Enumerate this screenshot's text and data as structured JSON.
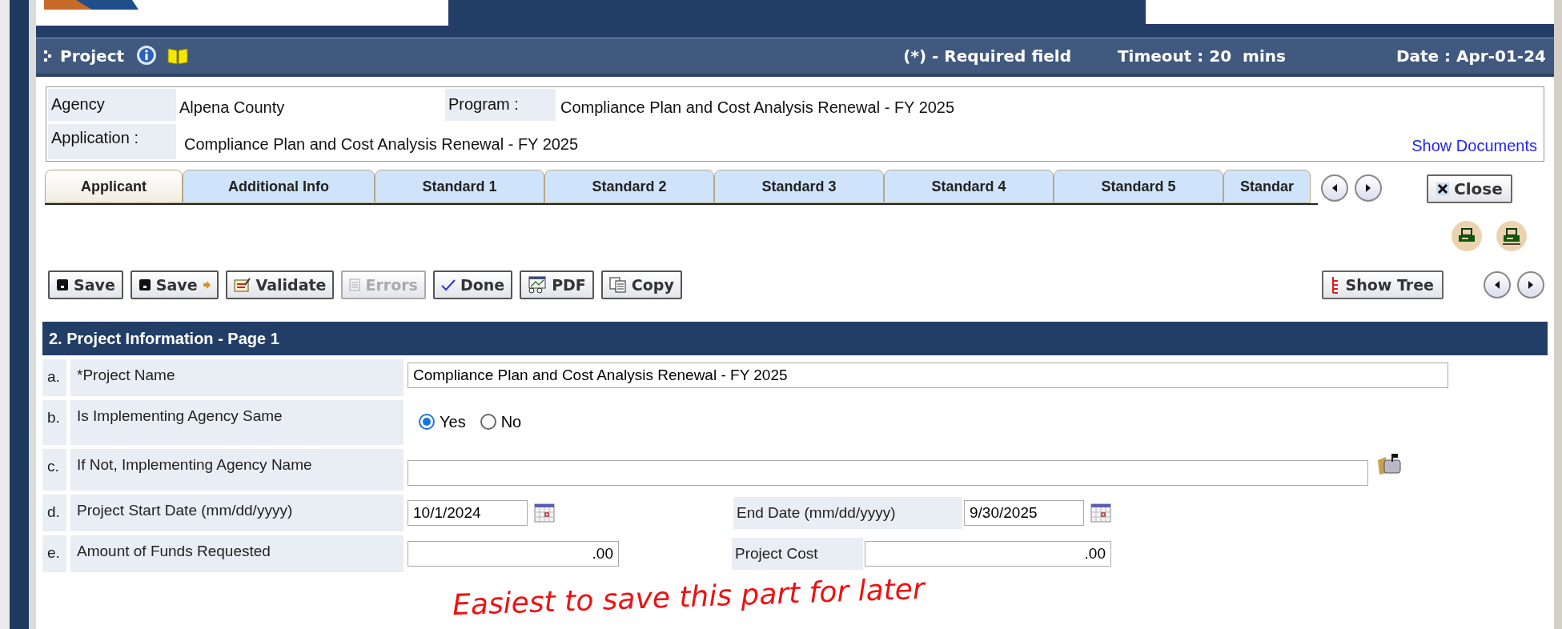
{
  "header": {
    "title": "Project",
    "required_note": "(*) - Required field",
    "timeout": "Timeout : 20  mins",
    "date": "Date : Apr-01-24"
  },
  "info": {
    "fields": [
      {
        "label": "Agency",
        "value": "Alpena County"
      },
      {
        "label": "Program :",
        "value": "Compliance Plan and Cost Analysis Renewal - FY 2025"
      },
      {
        "label": "Application :",
        "value": "Compliance Plan and Cost Analysis Renewal - FY 2025"
      }
    ],
    "link": "Show Documents"
  },
  "tabs": [
    {
      "label": "Applicant",
      "selected": true
    },
    {
      "label": "Additional Info",
      "selected": false
    },
    {
      "label": "Standard 1",
      "selected": false
    },
    {
      "label": "Standard 2",
      "selected": false
    },
    {
      "label": "Standard 3",
      "selected": false
    },
    {
      "label": "Standard 4",
      "selected": false
    },
    {
      "label": "Standard 5",
      "selected": false
    },
    {
      "label": "Standar",
      "selected": false
    }
  ],
  "close_button": "Close",
  "toolbar": [
    {
      "label": "Save",
      "kind": "save",
      "disabled": false
    },
    {
      "label": "Save",
      "kind": "savenext",
      "disabled": false
    },
    {
      "label": "Validate",
      "kind": "validate",
      "disabled": false
    },
    {
      "label": "Errors",
      "kind": "errors",
      "disabled": true
    },
    {
      "label": "Done",
      "kind": "done",
      "disabled": false
    },
    {
      "label": "PDF",
      "kind": "pdf",
      "disabled": false
    },
    {
      "label": "Copy",
      "kind": "copy",
      "disabled": false
    }
  ],
  "show_tree": "Show Tree",
  "section": {
    "title": "2. Project Information - Page 1",
    "rows": [
      {
        "letter": "a.",
        "label": "*Project Name",
        "kind": "text",
        "value": "Compliance Plan and Cost Analysis Renewal - FY 2025"
      },
      {
        "letter": "b.",
        "label": "Is Implementing Agency Same",
        "kind": "radio",
        "options": [
          {
            "label": "Yes",
            "selected": true
          },
          {
            "label": "No",
            "selected": false
          }
        ]
      },
      {
        "letter": "c.",
        "label": "If Not, Implementing Agency Name",
        "kind": "lookup"
      },
      {
        "letter": "d.",
        "label": "Project Start Date (mm/dd/yyyy)",
        "kind": "date",
        "value": "10/1/2024",
        "extra": {
          "label": "End Date (mm/dd/yyyy)",
          "value": "9/30/2025",
          "kind": "date"
        }
      },
      {
        "letter": "e.",
        "label": "Amount of Funds Requested",
        "kind": "amount",
        "value": ".00",
        "extra": {
          "label": "Project Cost",
          "value": ".00",
          "kind": "amount"
        }
      }
    ]
  },
  "annotation": "Easiest to save this part for later"
}
